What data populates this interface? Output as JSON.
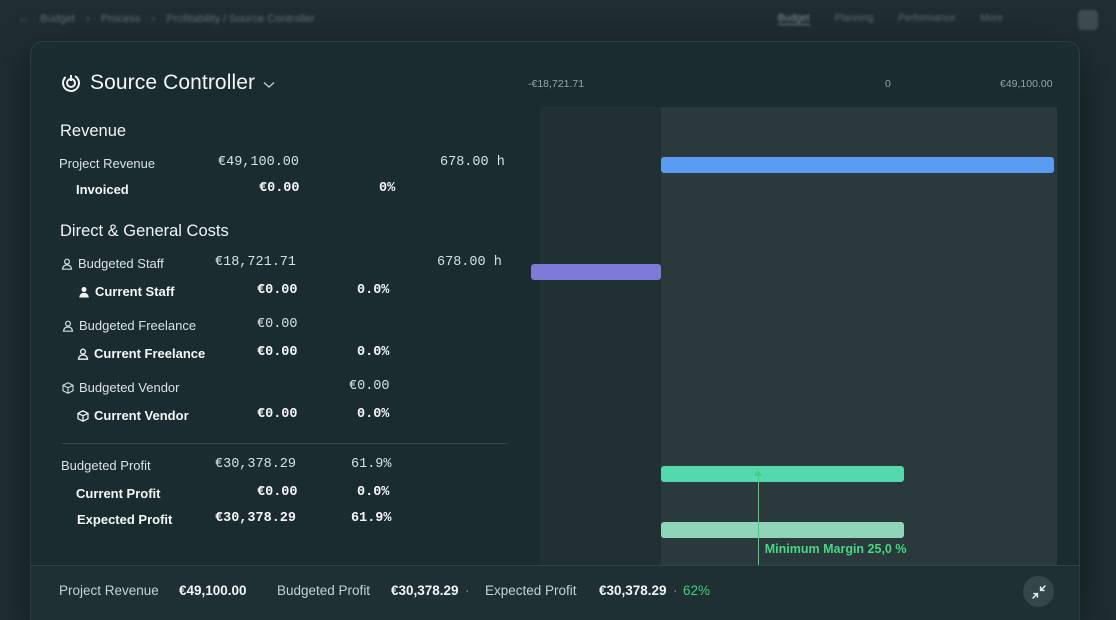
{
  "bg": {
    "crumbs": [
      "←",
      "Budget",
      "›",
      "Process",
      "›",
      "Profitability / Source Controller"
    ],
    "nav": [
      "Budget",
      "Planning",
      "Performance",
      "More"
    ]
  },
  "title": "Source Controller",
  "revenue": {
    "heading": "Revenue",
    "project_revenue": {
      "label": "Project Revenue",
      "amount": "€49,100.00",
      "hours": "678.00 h"
    },
    "invoiced": {
      "label": "Invoiced",
      "amount": "€0.00",
      "pct": "0%"
    }
  },
  "costs": {
    "heading": "Direct & General Costs",
    "budgeted_staff": {
      "label": "Budgeted Staff",
      "amount": "€18,721.71",
      "hours": "678.00 h"
    },
    "current_staff": {
      "label": "Current Staff",
      "amount": "€0.00",
      "pct": "0.0%"
    },
    "budgeted_freelance": {
      "label": "Budgeted Freelance",
      "amount": "€0.00"
    },
    "current_freelance": {
      "label": "Current Freelance",
      "amount": "€0.00",
      "pct": "0.0%"
    },
    "budgeted_vendor": {
      "label": "Budgeted Vendor",
      "amount": "€0.00"
    },
    "current_vendor": {
      "label": "Current Vendor",
      "amount": "€0.00",
      "pct": "0.0%"
    }
  },
  "profit": {
    "budgeted": {
      "label": "Budgeted Profit",
      "amount": "€30,378.29",
      "pct": "61.9%"
    },
    "current": {
      "label": "Current Profit",
      "amount": "€0.00",
      "pct": "0.0%"
    },
    "expected": {
      "label": "Expected Profit",
      "amount": "€30,378.29",
      "pct": "61.9%"
    }
  },
  "chart": {
    "ticks": [
      "-€18,721.71",
      "0",
      "€49,100.00"
    ],
    "min_margin_label": "Minimum Margin 25,0 %"
  },
  "footer": {
    "project_revenue_label": "Project Revenue",
    "project_revenue_value": "€49,100.00",
    "budgeted_profit_label": "Budgeted Profit",
    "budgeted_profit_value": "€30,378.29",
    "expected_profit_label": "Expected Profit",
    "expected_profit_value": "€30,378.29",
    "expected_profit_pct": "62%",
    "sep": "·"
  },
  "colors": {
    "revenue_bar": "#5a9cf2",
    "staff_bar": "#7d7bd6",
    "budgeted_profit_bar": "#54d8ae",
    "expected_profit_bar": "#8fd6b8",
    "min_margin": "#3ed07a"
  },
  "chart_data": {
    "type": "bar",
    "orientation": "horizontal",
    "xlim": [
      -18721.71,
      49100.0
    ],
    "min_margin_pct": 25.0,
    "bars": [
      {
        "row": "project_revenue",
        "value": 49100.0
      },
      {
        "row": "budgeted_staff",
        "value": -18721.71
      },
      {
        "row": "budgeted_profit",
        "value": 30378.29
      },
      {
        "row": "expected_profit",
        "value": 30378.29
      }
    ]
  }
}
